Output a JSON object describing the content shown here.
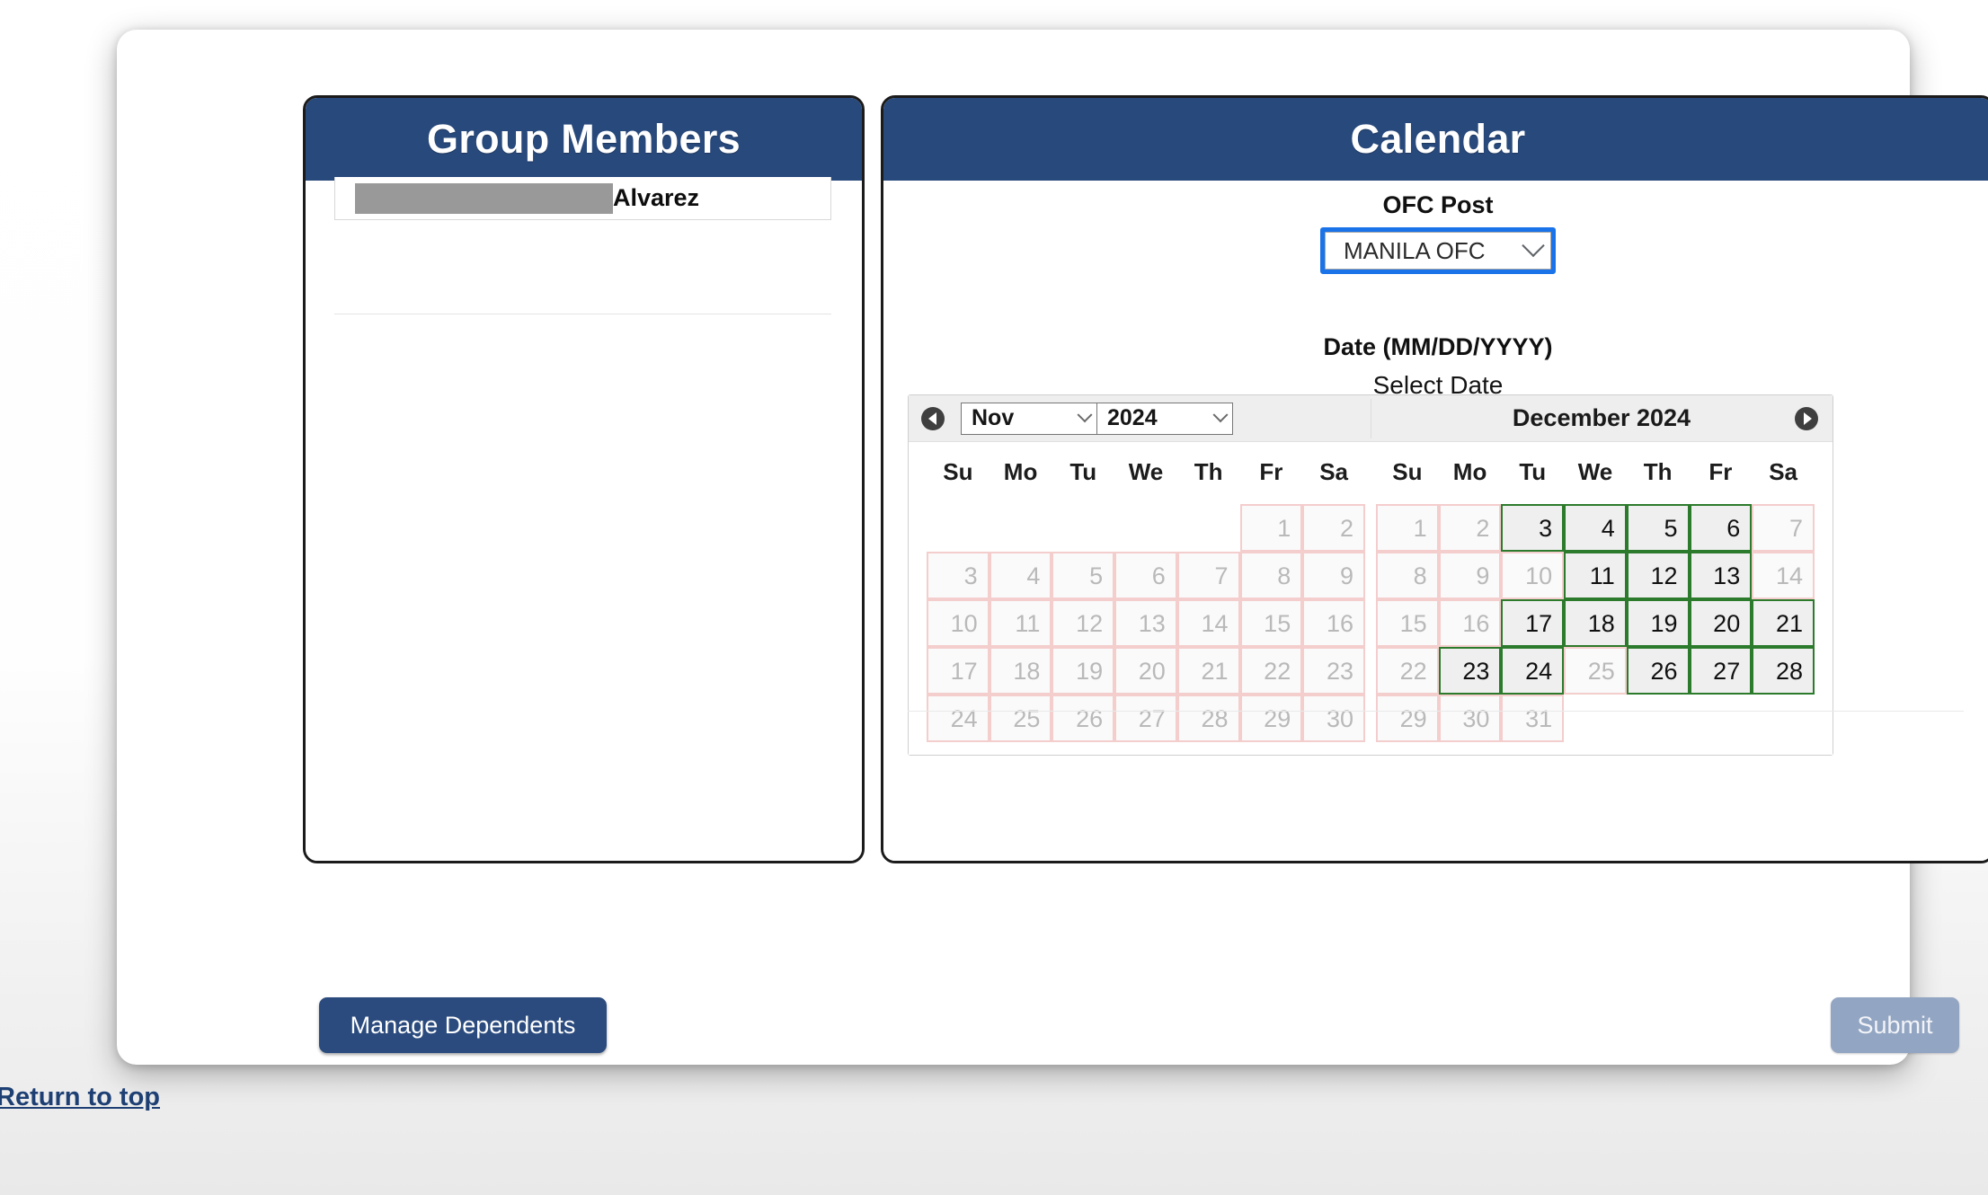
{
  "members_panel": {
    "title": "Group Members",
    "rows": [
      {
        "redacted": true,
        "last_name": "Alvarez"
      }
    ]
  },
  "calendar_panel": {
    "title": "Calendar",
    "ofc_post_label": "OFC Post",
    "ofc_post_value": "MANILA OFC",
    "date_label": "Date (MM/DD/YYYY)",
    "select_date_text": "Select Date",
    "datepicker": {
      "prev_icon": "prev-arrow-icon",
      "next_icon": "next-arrow-icon",
      "month_select_value": "Nov",
      "year_select_value": "2024",
      "right_title": "December 2024",
      "weekdays": [
        "Su",
        "Mo",
        "Tu",
        "We",
        "Th",
        "Fr",
        "Sa"
      ],
      "left_month": {
        "name": "November 2024",
        "weeks": [
          [
            null,
            null,
            null,
            null,
            null,
            {
              "d": 1,
              "e": false
            },
            {
              "d": 2,
              "e": false
            }
          ],
          [
            {
              "d": 3,
              "e": false
            },
            {
              "d": 4,
              "e": false
            },
            {
              "d": 5,
              "e": false
            },
            {
              "d": 6,
              "e": false
            },
            {
              "d": 7,
              "e": false
            },
            {
              "d": 8,
              "e": false
            },
            {
              "d": 9,
              "e": false
            }
          ],
          [
            {
              "d": 10,
              "e": false
            },
            {
              "d": 11,
              "e": false
            },
            {
              "d": 12,
              "e": false
            },
            {
              "d": 13,
              "e": false
            },
            {
              "d": 14,
              "e": false
            },
            {
              "d": 15,
              "e": false
            },
            {
              "d": 16,
              "e": false
            }
          ],
          [
            {
              "d": 17,
              "e": false
            },
            {
              "d": 18,
              "e": false
            },
            {
              "d": 19,
              "e": false
            },
            {
              "d": 20,
              "e": false
            },
            {
              "d": 21,
              "e": false
            },
            {
              "d": 22,
              "e": false
            },
            {
              "d": 23,
              "e": false
            }
          ],
          [
            {
              "d": 24,
              "e": false
            },
            {
              "d": 25,
              "e": false
            },
            {
              "d": 26,
              "e": false
            },
            {
              "d": 27,
              "e": false
            },
            {
              "d": 28,
              "e": false
            },
            {
              "d": 29,
              "e": false
            },
            {
              "d": 30,
              "e": false
            }
          ]
        ]
      },
      "right_month": {
        "name": "December 2024",
        "weeks": [
          [
            {
              "d": 1,
              "e": false
            },
            {
              "d": 2,
              "e": false
            },
            {
              "d": 3,
              "e": true
            },
            {
              "d": 4,
              "e": true
            },
            {
              "d": 5,
              "e": true
            },
            {
              "d": 6,
              "e": true
            },
            {
              "d": 7,
              "e": false
            }
          ],
          [
            {
              "d": 8,
              "e": false
            },
            {
              "d": 9,
              "e": false
            },
            {
              "d": 10,
              "e": false
            },
            {
              "d": 11,
              "e": true
            },
            {
              "d": 12,
              "e": true
            },
            {
              "d": 13,
              "e": true
            },
            {
              "d": 14,
              "e": false
            }
          ],
          [
            {
              "d": 15,
              "e": false
            },
            {
              "d": 16,
              "e": false
            },
            {
              "d": 17,
              "e": true
            },
            {
              "d": 18,
              "e": true
            },
            {
              "d": 19,
              "e": true
            },
            {
              "d": 20,
              "e": true
            },
            {
              "d": 21,
              "e": true
            }
          ],
          [
            {
              "d": 22,
              "e": false
            },
            {
              "d": 23,
              "e": true
            },
            {
              "d": 24,
              "e": true
            },
            {
              "d": 25,
              "e": false
            },
            {
              "d": 26,
              "e": true
            },
            {
              "d": 27,
              "e": true
            },
            {
              "d": 28,
              "e": true
            }
          ],
          [
            {
              "d": 29,
              "e": false
            },
            {
              "d": 30,
              "e": false
            },
            {
              "d": 31,
              "e": false
            },
            null,
            null,
            null,
            null
          ]
        ]
      }
    }
  },
  "footer": {
    "manage_dependents_label": "Manage Dependents",
    "submit_label": "Submit",
    "return_to_top_label": "Return to top"
  },
  "colors": {
    "header_blue": "#28497c",
    "focus_blue": "#1a73e8",
    "enabled_border_green": "#2c7a2c",
    "disabled_border_pink": "#f4cdcd",
    "primary_button": "#2b4b7e",
    "disabled_button": "#92a5c2",
    "link_navy": "#1d3f73"
  }
}
